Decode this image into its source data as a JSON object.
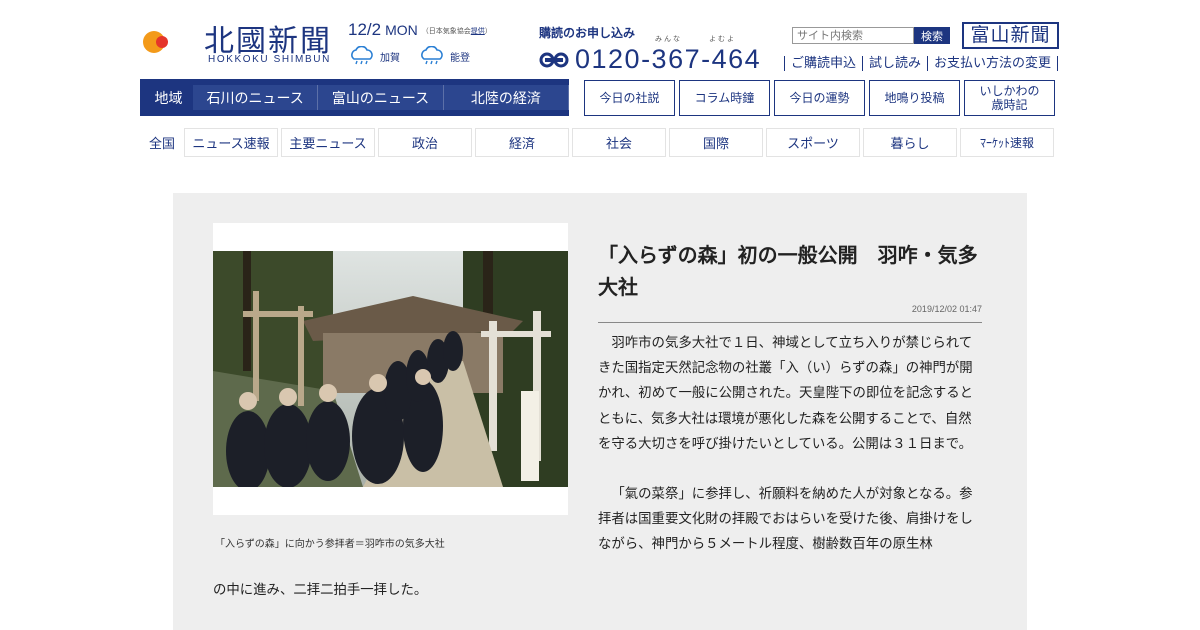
{
  "header": {
    "logo_title": "北國新聞",
    "logo_sub": "HOKKOKU SHIMBUN",
    "date": "12/2",
    "weekday": "MON",
    "weather_note_prefix": "（日本気象協会",
    "weather_note_link": "提供",
    "weather_note_suffix": "）",
    "weather": [
      {
        "place": "加賀",
        "icon": "rain-cloud-icon"
      },
      {
        "place": "能登",
        "icon": "rain-cloud-icon"
      }
    ],
    "subscribe_title": "購読のお申し込み",
    "ruby_1": "みんな",
    "ruby_2": "よむよ",
    "phone": "0120-367-464",
    "search_placeholder": "サイト内検索",
    "search_button": "検索",
    "toyama_logo": "富山新聞",
    "links": [
      "ご購読申込",
      "試し読み",
      "お支払い方法の変更"
    ]
  },
  "region_nav": {
    "label": "地域",
    "tabs": [
      "石川のニュース",
      "富山のニュース",
      "北陸の経済"
    ]
  },
  "column_buttons": [
    "今日の社説",
    "コラム時鐘",
    "今日の運勢",
    "地鳴り投稿",
    "いしかわの\n歳時記"
  ],
  "category_nav": {
    "label": "全国",
    "items": [
      "ニュース速報",
      "主要ニュース",
      "政治",
      "経済",
      "社会",
      "国際",
      "スポーツ",
      "暮らし",
      "ﾏｰｹｯﾄ速報"
    ]
  },
  "article": {
    "headline": "「入らずの森」初の一般公開　羽咋・気多大社",
    "timestamp": "2019/12/02 01:47",
    "caption": "「入らずの森」に向かう参拝者＝羽咋市の気多大社",
    "paragraph_1": "羽咋市の気多大社で１日、神域として立ち入りが禁じられてきた国指定天然記念物の社叢「入（い）らずの森」の神門が開かれ、初めて一般に公開された。天皇陛下の即位を記念するとともに、気多大社は環境が悪化した森を公開することで、自然を守る大切さを呼び掛けたいとしている。公開は３１日まで。",
    "paragraph_2": "「氣の菜祭」に参拝し、祈願料を納めた人が対象となる。参拝者は国重要文化財の拝殿でおはらいを受けた後、肩掛けをしながら、神門から５メートル程度、樹齢数百年の原生林",
    "paragraph_tail": "の中に進み、二拝二拍手一拝した。"
  },
  "colors": {
    "brand_navy": "#1d3580",
    "panel_gray": "#eeeeee"
  }
}
